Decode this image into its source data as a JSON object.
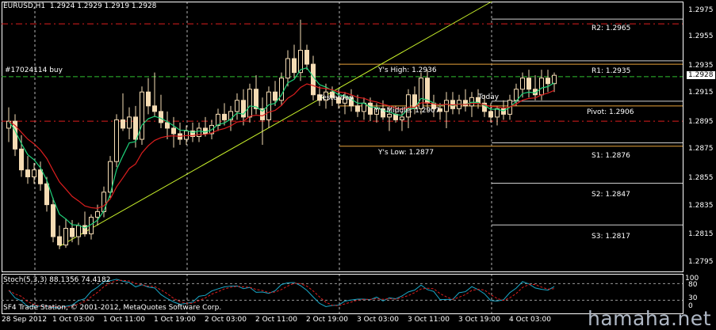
{
  "header": {
    "symbol": "EURUSD,H1",
    "ohlc": "1.2924 1.2929 1.2919 1.2928"
  },
  "order_label": "#17024114 buy",
  "current_price_tag": "1.2928",
  "pivot_labels": {
    "r2": "R2: 1.2965",
    "r1": "R1: 1.2935",
    "pivot": "Pivot: 1.2906",
    "s1": "S1: 1.2876",
    "s2": "S2: 1.2847",
    "s3": "S3: 1.2817"
  },
  "range_labels": {
    "high": "Y's High: 1.2936",
    "middle": "Y's Middle: 1.2907",
    "low": "Y's Low: 1.2877",
    "yesterday": "Yesterday",
    "today": "Today"
  },
  "stoch_header": "Stoch(5,3,3) 88.1356 74.4182",
  "copyright": "SF4 Trade Station, © 2001-2012, MetaQuotes Software Corp.",
  "watermark": "hamaha.net",
  "colors": {
    "background": "#000000",
    "candle": "#f5dcb4",
    "grid": "#ffffff",
    "pivot_red": "#dc1e1e",
    "range_orange": "#e8a23a",
    "order_green": "#2fbf2f",
    "trend_yellow": "#c8f02a",
    "ma_fast": "#1ed27a",
    "ma_slow": "#dc1e1e",
    "stoch_main": "#1aa8c8",
    "stoch_signal": "#dc1e1e"
  },
  "chart_data": {
    "type": "candlestick",
    "title": "EURUSD,H1",
    "y_ticks": [
      "1.2975",
      "1.2955",
      "1.2935",
      "1.2915",
      "1.2895",
      "1.2875",
      "1.2855",
      "1.2835",
      "1.2815",
      "1.2795"
    ],
    "x_ticks": [
      "28 Sep 2012",
      "1 Oct 03:00",
      "1 Oct 11:00",
      "1 Oct 19:00",
      "2 Oct 03:00",
      "2 Oct 11:00",
      "2 Oct 19:00",
      "3 Oct 03:00",
      "3 Oct 11:00",
      "3 Oct 19:00",
      "4 Oct 03:00"
    ],
    "ylim": [
      1.2787,
      1.2981
    ],
    "candles": [
      [
        1.289,
        1.2905,
        1.288,
        1.2895
      ],
      [
        1.2895,
        1.29,
        1.287,
        1.2875
      ],
      [
        1.2875,
        1.2885,
        1.2855,
        1.286
      ],
      [
        1.286,
        1.287,
        1.285,
        1.2855
      ],
      [
        1.2855,
        1.2865,
        1.285,
        1.286
      ],
      [
        1.286,
        1.2866,
        1.2845,
        1.285
      ],
      [
        1.285,
        1.2855,
        1.283,
        1.2835
      ],
      [
        1.2835,
        1.284,
        1.2808,
        1.2812
      ],
      [
        1.2812,
        1.282,
        1.2803,
        1.2806
      ],
      [
        1.2806,
        1.2825,
        1.2804,
        1.2818
      ],
      [
        1.2818,
        1.2824,
        1.2808,
        1.2812
      ],
      [
        1.2812,
        1.2822,
        1.2806,
        1.282
      ],
      [
        1.282,
        1.283,
        1.2812,
        1.2814
      ],
      [
        1.2814,
        1.2828,
        1.281,
        1.2826
      ],
      [
        1.2826,
        1.2835,
        1.282,
        1.283
      ],
      [
        1.283,
        1.2848,
        1.2826,
        1.2844
      ],
      [
        1.2844,
        1.287,
        1.284,
        1.2866
      ],
      [
        1.2866,
        1.29,
        1.2862,
        1.2896
      ],
      [
        1.2896,
        1.2915,
        1.2888,
        1.289
      ],
      [
        1.289,
        1.2905,
        1.2882,
        1.2898
      ],
      [
        1.2898,
        1.2906,
        1.2876,
        1.2882
      ],
      [
        1.2882,
        1.292,
        1.2878,
        1.2916
      ],
      [
        1.2916,
        1.2926,
        1.29,
        1.2906
      ],
      [
        1.2906,
        1.293,
        1.2898,
        1.2902
      ],
      [
        1.2902,
        1.2914,
        1.289,
        1.2894
      ],
      [
        1.2894,
        1.2902,
        1.2882,
        1.289
      ],
      [
        1.289,
        1.2898,
        1.2876,
        1.2886
      ],
      [
        1.2886,
        1.2894,
        1.2878,
        1.2882
      ],
      [
        1.2882,
        1.2892,
        1.2878,
        1.2888
      ],
      [
        1.2888,
        1.2894,
        1.288,
        1.2884
      ],
      [
        1.2884,
        1.2894,
        1.288,
        1.289
      ],
      [
        1.289,
        1.2898,
        1.2884,
        1.2886
      ],
      [
        1.2886,
        1.2896,
        1.2882,
        1.2892
      ],
      [
        1.2892,
        1.2904,
        1.2888,
        1.29
      ],
      [
        1.29,
        1.2908,
        1.2892,
        1.2896
      ],
      [
        1.2896,
        1.2906,
        1.2888,
        1.2902
      ],
      [
        1.2902,
        1.2915,
        1.2896,
        1.291
      ],
      [
        1.291,
        1.2918,
        1.2892,
        1.2898
      ],
      [
        1.2898,
        1.2922,
        1.2894,
        1.2918
      ],
      [
        1.2918,
        1.2928,
        1.29,
        1.2904
      ],
      [
        1.2904,
        1.2912,
        1.2878,
        1.2896
      ],
      [
        1.2896,
        1.292,
        1.289,
        1.2916
      ],
      [
        1.2916,
        1.2924,
        1.2906,
        1.291
      ],
      [
        1.291,
        1.293,
        1.2906,
        1.2926
      ],
      [
        1.2926,
        1.2946,
        1.292,
        1.294
      ],
      [
        1.294,
        1.295,
        1.2926,
        1.293
      ],
      [
        1.293,
        1.2968,
        1.2924,
        1.2946
      ],
      [
        1.2946,
        1.295,
        1.2932,
        1.2936
      ],
      [
        1.2936,
        1.2942,
        1.291,
        1.2914
      ],
      [
        1.2914,
        1.292,
        1.2906,
        1.291
      ],
      [
        1.291,
        1.2922,
        1.2904,
        1.2916
      ],
      [
        1.2916,
        1.292,
        1.2906,
        1.2912
      ],
      [
        1.2912,
        1.2918,
        1.2904,
        1.2908
      ],
      [
        1.2908,
        1.2916,
        1.29,
        1.2912
      ],
      [
        1.2912,
        1.2918,
        1.2902,
        1.2906
      ],
      [
        1.2906,
        1.2914,
        1.2898,
        1.2902
      ],
      [
        1.2902,
        1.2912,
        1.2896,
        1.2908
      ],
      [
        1.2908,
        1.2912,
        1.2895,
        1.29
      ],
      [
        1.29,
        1.2908,
        1.2894,
        1.2904
      ],
      [
        1.2904,
        1.291,
        1.2896,
        1.2898
      ],
      [
        1.2898,
        1.2906,
        1.2888,
        1.29
      ],
      [
        1.29,
        1.2906,
        1.2894,
        1.2896
      ],
      [
        1.2896,
        1.2902,
        1.2888,
        1.2898
      ],
      [
        1.2898,
        1.2918,
        1.289,
        1.2914
      ],
      [
        1.2914,
        1.292,
        1.29,
        1.2904
      ],
      [
        1.2904,
        1.293,
        1.29,
        1.2926
      ],
      [
        1.2926,
        1.2932,
        1.2902,
        1.2908
      ],
      [
        1.2908,
        1.2914,
        1.2898,
        1.2904
      ],
      [
        1.2904,
        1.2908,
        1.2896,
        1.2902
      ],
      [
        1.2902,
        1.2916,
        1.289,
        1.291
      ],
      [
        1.291,
        1.2916,
        1.29,
        1.2904
      ],
      [
        1.2904,
        1.2914,
        1.29,
        1.291
      ],
      [
        1.291,
        1.2918,
        1.2902,
        1.2906
      ],
      [
        1.2906,
        1.2916,
        1.2898,
        1.2912
      ],
      [
        1.2912,
        1.2918,
        1.2904,
        1.2908
      ],
      [
        1.2908,
        1.2914,
        1.2898,
        1.2902
      ],
      [
        1.2902,
        1.2908,
        1.2894,
        1.2898
      ],
      [
        1.2898,
        1.2906,
        1.2892,
        1.2904
      ],
      [
        1.2904,
        1.291,
        1.2896,
        1.29
      ],
      [
        1.29,
        1.2914,
        1.2896,
        1.291
      ],
      [
        1.291,
        1.2922,
        1.2906,
        1.2918
      ],
      [
        1.2918,
        1.293,
        1.2912,
        1.2926
      ],
      [
        1.2926,
        1.2932,
        1.2912,
        1.2918
      ],
      [
        1.2918,
        1.2928,
        1.291,
        1.2914
      ],
      [
        1.2914,
        1.2932,
        1.291,
        1.2926
      ],
      [
        1.2926,
        1.2932,
        1.2916,
        1.2922
      ],
      [
        1.2922,
        1.293,
        1.2916,
        1.2928
      ]
    ],
    "ma_fast_start": 1.2885,
    "stoch_levels": [
      "100",
      "80",
      "30",
      "0"
    ]
  }
}
